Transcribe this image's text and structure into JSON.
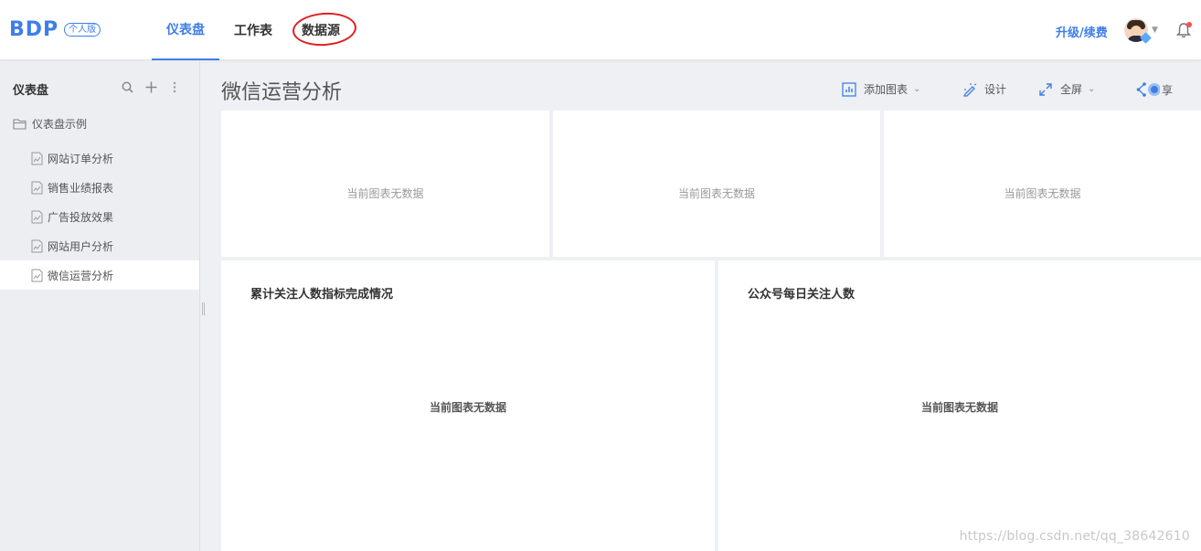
{
  "header": {
    "logo": "BDP",
    "logo_badge": "个人版",
    "tabs": [
      {
        "label": "仪表盘",
        "active": true
      },
      {
        "label": "工作表",
        "active": false
      },
      {
        "label": "数据源",
        "active": false
      }
    ],
    "upgrade_label": "升级/续费"
  },
  "sidebar": {
    "title": "仪表盘",
    "folder": "仪表盘示例",
    "items": [
      {
        "label": "网站订单分析"
      },
      {
        "label": "销售业绩报表"
      },
      {
        "label": "广告投放效果"
      },
      {
        "label": "网站用户分析"
      },
      {
        "label": "微信运营分析",
        "active": true
      }
    ]
  },
  "main": {
    "title": "微信运营分析",
    "toolbar": {
      "add_chart": "添加图表",
      "design": "设计",
      "fullscreen": "全屏",
      "share": "享"
    },
    "cards_top": [
      {
        "empty": "当前图表无数据"
      },
      {
        "empty": "当前图表无数据"
      },
      {
        "empty": "当前图表无数据"
      }
    ],
    "cards_bottom": [
      {
        "title": "累计关注人数指标完成情况",
        "empty": "当前图表无数据"
      },
      {
        "title": "公众号每日关注人数",
        "empty": "当前图表无数据"
      }
    ]
  },
  "watermark": "https://blog.csdn.net/qq_38642610",
  "colors": {
    "accent": "#3f7ee8",
    "annotation": "#e02020"
  }
}
